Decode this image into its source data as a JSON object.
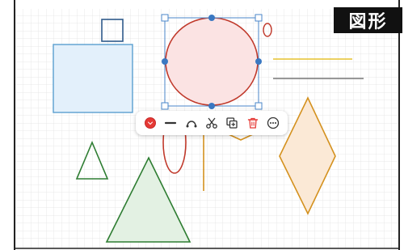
{
  "badge": {
    "label": "図形"
  },
  "colors": {
    "grid": "#e3e3e3",
    "selection": "#4a86c8",
    "circle_fill": "#fbe3e3",
    "circle_stroke": "#c0392b",
    "square_stroke": "#3a6ea5",
    "blue_rect_fill": "#e3f0fb",
    "blue_rect_stroke": "#5a9fd0",
    "green_stroke": "#2e7d32",
    "green_fill": "#e3f1e3",
    "orange_stroke": "#d4911e",
    "orange_fill": "#fbe9d6",
    "yellow_line": "#e6c22e",
    "gray_line": "#777777",
    "color_dot": "#e53935"
  },
  "toolbar": {
    "tools": [
      {
        "name": "color-picker",
        "icon": "color-dot-icon"
      },
      {
        "name": "stroke-width",
        "icon": "stroke-line-icon"
      },
      {
        "name": "curve-edit",
        "icon": "curve-icon"
      },
      {
        "name": "cut",
        "icon": "scissors-icon"
      },
      {
        "name": "duplicate",
        "icon": "copy-icon"
      },
      {
        "name": "delete",
        "icon": "trash-icon"
      },
      {
        "name": "more",
        "icon": "more-icon"
      }
    ]
  }
}
